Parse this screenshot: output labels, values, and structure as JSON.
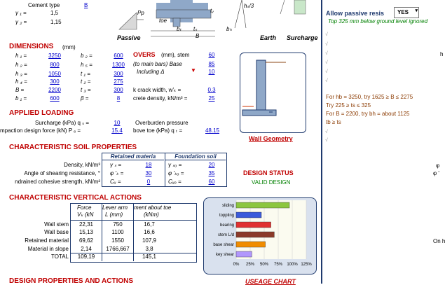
{
  "top": {
    "cement_type_label": "Cement type",
    "cement_type_value": "B",
    "gamma1_label": "γ ₁ =",
    "gamma1_value": "1,5",
    "gamma2_label": "γ ₂ =",
    "gamma2_value": "1,15",
    "passive_label": "Passive",
    "toe_label": "toe",
    "earth_label": "Earth",
    "surcharge_label": "Surcharge",
    "fig_labels": {
      "pp": "Pp",
      "hs": "hₛ/3",
      "bt": "bₜ",
      "b": "B",
      "tb": "tₛ",
      "bh": "bₕ",
      "tw": "tᵥ"
    }
  },
  "dimensions": {
    "title": "DIMENSIONS",
    "unit": "(mm)",
    "left_rows": [
      {
        "label": "h ₁ =",
        "value": "3250"
      },
      {
        "label": "h ₂ =",
        "value": "800"
      },
      {
        "label": "h ₃ =",
        "value": "1050"
      },
      {
        "label": "h ₄ =",
        "value": "300"
      },
      {
        "label": "B =",
        "value": "2200"
      },
      {
        "label": "b ₁ =",
        "value": "600"
      }
    ],
    "mid_rows": [
      {
        "label": "b ₂ =",
        "value": "600"
      },
      {
        "label": "h ₅ =",
        "value": "1300"
      },
      {
        "label": "t ₁ =",
        "value": "300"
      },
      {
        "label": "t ₂ =",
        "value": "275"
      },
      {
        "label": "t ₃ =",
        "value": "300"
      },
      {
        "label": "β =",
        "value": "8"
      }
    ],
    "covers_title": "OVERS",
    "covers_unit": "(mm), stem",
    "covers_value": "60",
    "main_bars_label": "(to main bars)  Base",
    "main_bars_value": "85",
    "including_label": "Including  Δ",
    "including_value": "10",
    "crack_label": "k crack width,  w'ₖ =",
    "crack_value": "0.3",
    "density_label": "crete density, kN/m³ =",
    "density_value": "25"
  },
  "loading": {
    "title": "APPLIED LOADING",
    "surcharge_label": "Surcharge (kPa)  q ₛ =",
    "surcharge_value": "10",
    "overburden_label": "Overburden pressure",
    "compaction_label": "mpaction design force (kN)  P ₑ =",
    "compaction_value": "15.4",
    "above_toe_label": "bove toe (kPa)  q ₜ =",
    "above_toe_value": "48.15"
  },
  "soil": {
    "title": "CHARACTERISTIC SOIL PROPERTIES",
    "col_retained": "Retained materia",
    "col_foundation": "Foundation soil",
    "rows": [
      {
        "label": "Density, kN/m³",
        "r_sym": "γ ₛ =",
        "r_val": "18",
        "f_sym": "γ ₛₒ =",
        "f_val": "20"
      },
      {
        "label": "Angle of shearing resistance, °",
        "r_sym": "φ 'ₖ =",
        "r_val": "30",
        "f_sym": "φ 'ₖₒ =",
        "f_val": "35"
      },
      {
        "label": "ndrained cohesive strength, kN/m²",
        "r_sym": "Cᵤ =",
        "r_val": "0",
        "f_sym": "Cᵤₒ =",
        "f_val": "60"
      }
    ]
  },
  "wall_geometry_label": "Wall Geometry",
  "design_status": {
    "title": "DESIGN STATUS",
    "value": "VALID DESIGN"
  },
  "vertical": {
    "title": "CHARACTERISTIC VERTICAL ACTIONS",
    "col_force": "Force",
    "col_force2": "Vₖ (kN",
    "col_lever": "Lever arm",
    "col_lever2": "L  (mm)",
    "col_moment": "ment about toe",
    "col_moment2": "(kNm)",
    "rows": [
      {
        "label": "Wall stem",
        "force": "22,31",
        "lever": "750",
        "moment": "16,7"
      },
      {
        "label": "Wall base",
        "force": "15,13",
        "lever": "1100",
        "moment": "16,6"
      },
      {
        "label": "Retained material",
        "force": "69,62",
        "lever": "1550",
        "moment": "107,9"
      },
      {
        "label": "Material in slope",
        "force": "2,14",
        "lever": "1766,667",
        "moment": "3,8"
      },
      {
        "label": "TOTAL",
        "force": "109,19",
        "lever": "",
        "moment": "145,1"
      }
    ]
  },
  "bottom": {
    "design_props_title": "DESIGN PROPERTIES AND ACTIONS",
    "usage_chart_title": "USEAGE CHART"
  },
  "chart_data": {
    "type": "bar",
    "categories": [
      "sliding",
      "toppling",
      "bearing",
      "stem L/d",
      "base shear",
      "key shear"
    ],
    "values": [
      95,
      45,
      62,
      68,
      52,
      28
    ],
    "colors": [
      "#8cc63f",
      "#3b5bdb",
      "#e03131",
      "#8b3a2a",
      "#f08c00",
      "#b197fc"
    ],
    "xlim": [
      0,
      125
    ],
    "xticks": [
      "0%",
      "25%",
      "50%",
      "75%",
      "100%",
      "125%"
    ]
  },
  "sidebar": {
    "passive_label": "Allow passive resis",
    "passive_select": "YES",
    "note": "Top 325 mm below ground level ignored",
    "rule1": "For hb = 3250, try 1625 ≥ B ≤ 2275",
    "rule2": "Try 225 ≥ ts ≤ 325",
    "rule3": "For B = 2200, try bh = about 1125",
    "rule4": "tb ≥ ts",
    "right_h": "h",
    "right_phi1": "φ",
    "right_phi2": "φ '",
    "right_onh": "On h",
    "check": "√"
  }
}
